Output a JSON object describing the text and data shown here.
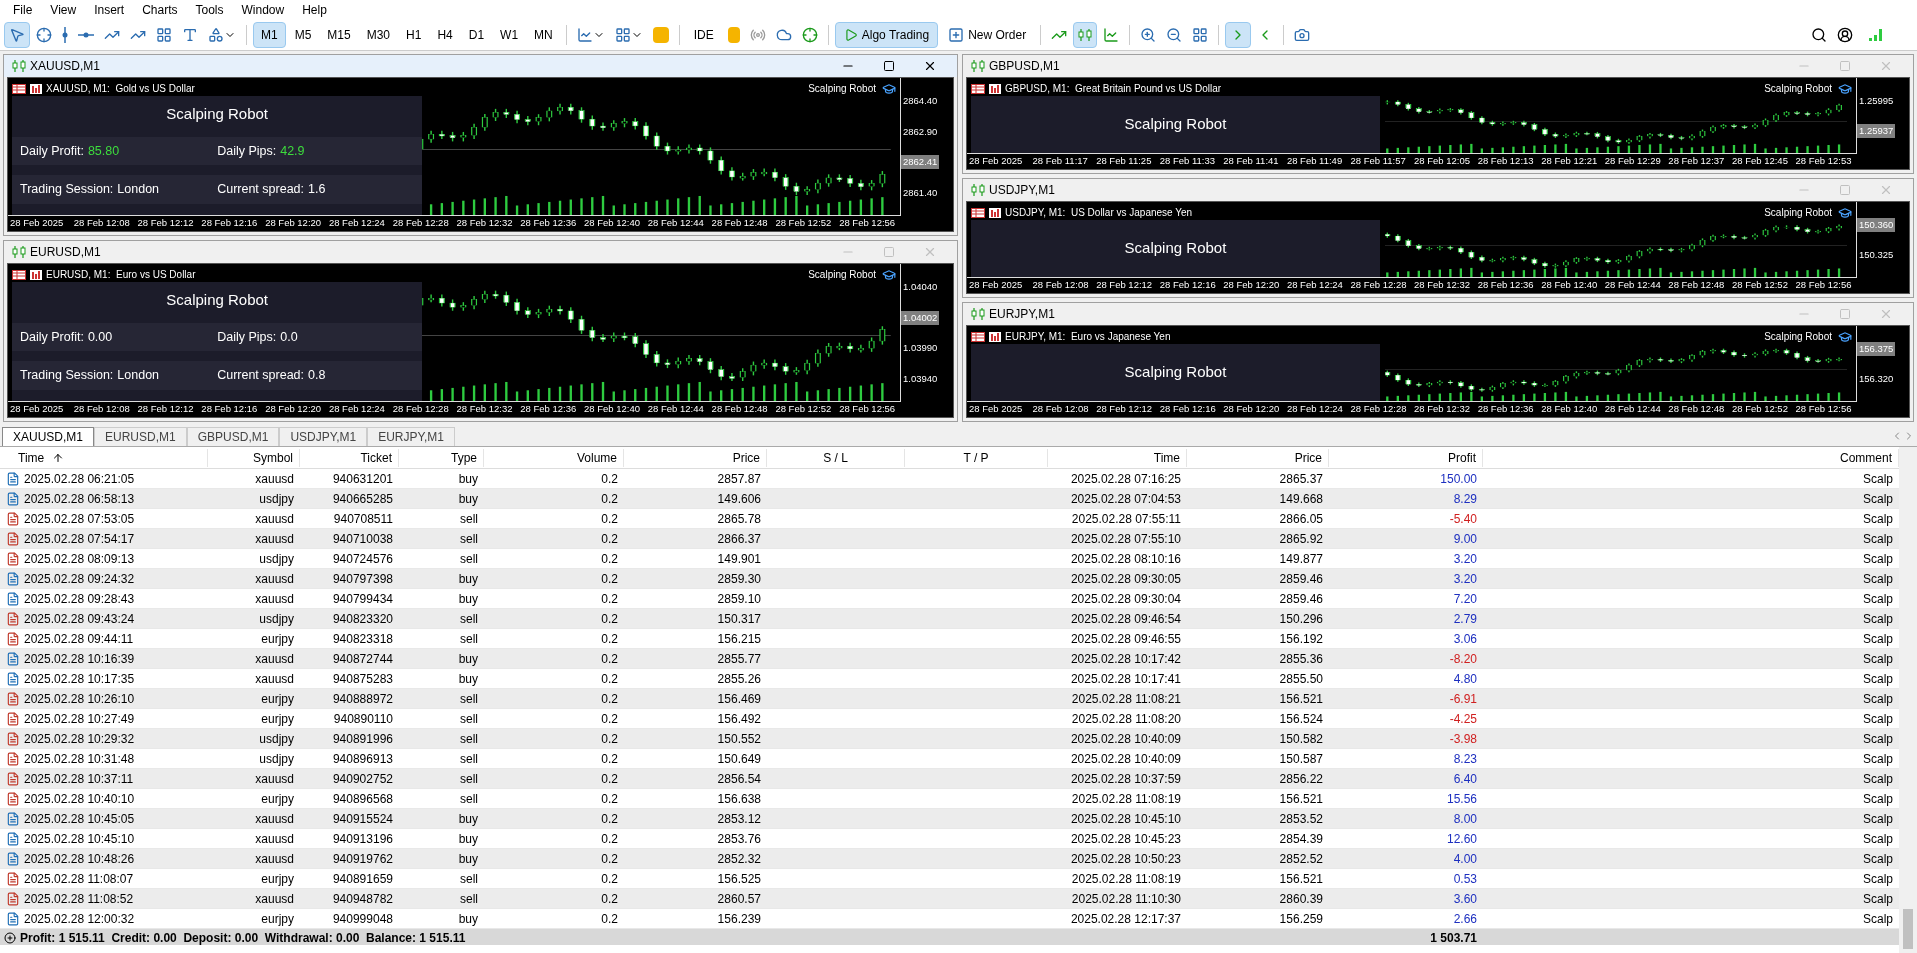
{
  "menu": [
    "File",
    "View",
    "Insert",
    "Charts",
    "Tools",
    "Window",
    "Help"
  ],
  "toolbar": {
    "timeframes": [
      {
        "label": "M1",
        "selected": true
      },
      {
        "label": "M5",
        "selected": false
      },
      {
        "label": "M15",
        "selected": false
      },
      {
        "label": "M30",
        "selected": false
      },
      {
        "label": "H1",
        "selected": false
      },
      {
        "label": "H4",
        "selected": false
      },
      {
        "label": "D1",
        "selected": false
      },
      {
        "label": "W1",
        "selected": false
      },
      {
        "label": "MN",
        "selected": false
      }
    ],
    "ide": "IDE",
    "algo_trading": {
      "label": "Algo Trading",
      "on": true
    },
    "new_order": "New Order"
  },
  "charts": [
    {
      "title": "XAUUSD,M1",
      "active": true,
      "symbol_text": "XAUUSD, M1:  Gold vs US Dollar",
      "robot_label": "Scalping Robot",
      "panel": {
        "title": "Scalping Robot",
        "rows": [
          [
            {
              "label": "Daily Profit:",
              "value": "85.80",
              "positive": true
            },
            {
              "label": "Daily Pips:",
              "value": "42.9",
              "positive": true
            }
          ],
          [
            {
              "label": "Trading Session:",
              "value": "London",
              "positive": false
            },
            {
              "label": "Current spread:",
              "value": "1.6",
              "positive": false
            }
          ]
        ]
      },
      "price_labels": [
        {
          "text": "2864.40",
          "current": false
        },
        {
          "text": "2862.90",
          "current": false
        },
        {
          "text": "2862.41",
          "current": true
        },
        {
          "text": "2861.40",
          "current": false
        }
      ],
      "time_labels": [
        "28 Feb 2025",
        "28 Feb 12:08",
        "28 Feb 12:12",
        "28 Feb 12:16",
        "28 Feb 12:20",
        "28 Feb 12:24",
        "28 Feb 12:28",
        "28 Feb 12:32",
        "28 Feb 12:36",
        "28 Feb 12:40",
        "28 Feb 12:44",
        "28 Feb 12:48",
        "28 Feb 12:52",
        "28 Feb 12:56"
      ]
    },
    {
      "title": "EURUSD,M1",
      "active": false,
      "symbol_text": "EURUSD, M1:  Euro vs US Dollar",
      "robot_label": "Scalping Robot",
      "panel": {
        "title": "Scalping Robot",
        "rows": [
          [
            {
              "label": "Daily Profit:",
              "value": "0.00",
              "positive": false
            },
            {
              "label": "Daily Pips:",
              "value": "0.0",
              "positive": false
            }
          ],
          [
            {
              "label": "Trading Session:",
              "value": "London",
              "positive": false
            },
            {
              "label": "Current spread:",
              "value": "0.8",
              "positive": false
            }
          ]
        ]
      },
      "price_labels": [
        {
          "text": "1.04040",
          "current": false
        },
        {
          "text": "1.04002",
          "current": true
        },
        {
          "text": "1.03990",
          "current": false
        },
        {
          "text": "1.03940",
          "current": false
        }
      ],
      "time_labels": [
        "28 Feb 2025",
        "28 Feb 12:08",
        "28 Feb 12:12",
        "28 Feb 12:16",
        "28 Feb 12:20",
        "28 Feb 12:24",
        "28 Feb 12:28",
        "28 Feb 12:32",
        "28 Feb 12:36",
        "28 Feb 12:40",
        "28 Feb 12:44",
        "28 Feb 12:48",
        "28 Feb 12:52",
        "28 Feb 12:56"
      ]
    },
    {
      "title": "GBPUSD,M1",
      "active": false,
      "symbol_text": "GBPUSD, M1:  Great Britain Pound vs US Dollar",
      "robot_label": "Scalping Robot",
      "panel": {
        "title": "Scalping Robot"
      },
      "price_labels": [
        {
          "text": "1.25995",
          "current": false
        },
        {
          "text": "1.25937",
          "current": true
        }
      ],
      "time_labels": [
        "28 Feb 2025",
        "28 Feb 11:17",
        "28 Feb 11:25",
        "28 Feb 11:33",
        "28 Feb 11:41",
        "28 Feb 11:49",
        "28 Feb 11:57",
        "28 Feb 12:05",
        "28 Feb 12:13",
        "28 Feb 12:21",
        "28 Feb 12:29",
        "28 Feb 12:37",
        "28 Feb 12:45",
        "28 Feb 12:53"
      ]
    },
    {
      "title": "USDJPY,M1",
      "active": false,
      "symbol_text": "USDJPY, M1:  US Dollar vs Japanese Yen",
      "robot_label": "Scalping Robot",
      "panel": {
        "title": "Scalping Robot"
      },
      "price_labels": [
        {
          "text": "150.360",
          "current": true
        },
        {
          "text": "150.325",
          "current": false
        }
      ],
      "time_labels": [
        "28 Feb 2025",
        "28 Feb 12:08",
        "28 Feb 12:12",
        "28 Feb 12:16",
        "28 Feb 12:20",
        "28 Feb 12:24",
        "28 Feb 12:28",
        "28 Feb 12:32",
        "28 Feb 12:36",
        "28 Feb 12:40",
        "28 Feb 12:44",
        "28 Feb 12:48",
        "28 Feb 12:52",
        "28 Feb 12:56"
      ]
    },
    {
      "title": "EURJPY,M1",
      "active": false,
      "symbol_text": "EURJPY, M1:  Euro vs Japanese Yen",
      "robot_label": "Scalping Robot",
      "panel": {
        "title": "Scalping Robot"
      },
      "price_labels": [
        {
          "text": "156.375",
          "current": true
        },
        {
          "text": "156.320",
          "current": false
        }
      ],
      "time_labels": [
        "28 Feb 2025",
        "28 Feb 12:08",
        "28 Feb 12:12",
        "28 Feb 12:16",
        "28 Feb 12:20",
        "28 Feb 12:24",
        "28 Feb 12:28",
        "28 Feb 12:32",
        "28 Feb 12:36",
        "28 Feb 12:40",
        "28 Feb 12:44",
        "28 Feb 12:48",
        "28 Feb 12:52",
        "28 Feb 12:56"
      ]
    }
  ],
  "chart_tabs": [
    {
      "label": "XAUUSD,M1",
      "selected": true
    },
    {
      "label": "EURUSD,M1",
      "selected": false
    },
    {
      "label": "GBPUSD,M1",
      "selected": false
    },
    {
      "label": "USDJPY,M1",
      "selected": false
    },
    {
      "label": "EURJPY,M1",
      "selected": false
    }
  ],
  "table": {
    "columns": [
      "Time",
      "Symbol",
      "Ticket",
      "Type",
      "Volume",
      "Price",
      "S / L",
      "T / P",
      "Time",
      "Price",
      "Profit",
      "Comment"
    ],
    "rows": [
      {
        "kind": "buy",
        "time": "2025.02.28 06:21:05",
        "symbol": "xauusd",
        "ticket": "940631201",
        "type": "buy",
        "volume": "0.2",
        "price": "2857.87",
        "close_time": "2025.02.28 07:16:25",
        "close_price": "2865.37",
        "profit": "150.00",
        "loss": false,
        "comment": "Scalp"
      },
      {
        "kind": "buy",
        "time": "2025.02.28 06:58:13",
        "symbol": "usdjpy",
        "ticket": "940665285",
        "type": "buy",
        "volume": "0.2",
        "price": "149.606",
        "close_time": "2025.02.28 07:04:53",
        "close_price": "149.668",
        "profit": "8.29",
        "loss": false,
        "comment": "Scalp"
      },
      {
        "kind": "sell",
        "time": "2025.02.28 07:53:05",
        "symbol": "xauusd",
        "ticket": "940708511",
        "type": "sell",
        "volume": "0.2",
        "price": "2865.78",
        "close_time": "2025.02.28 07:55:11",
        "close_price": "2866.05",
        "profit": "-5.40",
        "loss": true,
        "comment": "Scalp"
      },
      {
        "kind": "sell",
        "time": "2025.02.28 07:54:17",
        "symbol": "xauusd",
        "ticket": "940710038",
        "type": "sell",
        "volume": "0.2",
        "price": "2866.37",
        "close_time": "2025.02.28 07:55:10",
        "close_price": "2865.92",
        "profit": "9.00",
        "loss": false,
        "comment": "Scalp"
      },
      {
        "kind": "sell",
        "time": "2025.02.28 08:09:13",
        "symbol": "usdjpy",
        "ticket": "940724576",
        "type": "sell",
        "volume": "0.2",
        "price": "149.901",
        "close_time": "2025.02.28 08:10:16",
        "close_price": "149.877",
        "profit": "3.20",
        "loss": false,
        "comment": "Scalp"
      },
      {
        "kind": "buy",
        "time": "2025.02.28 09:24:32",
        "symbol": "xauusd",
        "ticket": "940797398",
        "type": "buy",
        "volume": "0.2",
        "price": "2859.30",
        "close_time": "2025.02.28 09:30:05",
        "close_price": "2859.46",
        "profit": "3.20",
        "loss": false,
        "comment": "Scalp"
      },
      {
        "kind": "buy",
        "time": "2025.02.28 09:28:43",
        "symbol": "xauusd",
        "ticket": "940799434",
        "type": "buy",
        "volume": "0.2",
        "price": "2859.10",
        "close_time": "2025.02.28 09:30:04",
        "close_price": "2859.46",
        "profit": "7.20",
        "loss": false,
        "comment": "Scalp"
      },
      {
        "kind": "sell",
        "time": "2025.02.28 09:43:24",
        "symbol": "usdjpy",
        "ticket": "940823320",
        "type": "sell",
        "volume": "0.2",
        "price": "150.317",
        "close_time": "2025.02.28 09:46:54",
        "close_price": "150.296",
        "profit": "2.79",
        "loss": false,
        "comment": "Scalp"
      },
      {
        "kind": "sell",
        "time": "2025.02.28 09:44:11",
        "symbol": "eurjpy",
        "ticket": "940823318",
        "type": "sell",
        "volume": "0.2",
        "price": "156.215",
        "close_time": "2025.02.28 09:46:55",
        "close_price": "156.192",
        "profit": "3.06",
        "loss": false,
        "comment": "Scalp"
      },
      {
        "kind": "buy",
        "time": "2025.02.28 10:16:39",
        "symbol": "xauusd",
        "ticket": "940872744",
        "type": "buy",
        "volume": "0.2",
        "price": "2855.77",
        "close_time": "2025.02.28 10:17:42",
        "close_price": "2855.36",
        "profit": "-8.20",
        "loss": true,
        "comment": "Scalp"
      },
      {
        "kind": "buy",
        "time": "2025.02.28 10:17:35",
        "symbol": "xauusd",
        "ticket": "940875283",
        "type": "buy",
        "volume": "0.2",
        "price": "2855.26",
        "close_time": "2025.02.28 10:17:41",
        "close_price": "2855.50",
        "profit": "4.80",
        "loss": false,
        "comment": "Scalp"
      },
      {
        "kind": "sell",
        "time": "2025.02.28 10:26:10",
        "symbol": "eurjpy",
        "ticket": "940888972",
        "type": "sell",
        "volume": "0.2",
        "price": "156.469",
        "close_time": "2025.02.28 11:08:21",
        "close_price": "156.521",
        "profit": "-6.91",
        "loss": true,
        "comment": "Scalp"
      },
      {
        "kind": "sell",
        "time": "2025.02.28 10:27:49",
        "symbol": "eurjpy",
        "ticket": "940890110",
        "type": "sell",
        "volume": "0.2",
        "price": "156.492",
        "close_time": "2025.02.28 11:08:20",
        "close_price": "156.524",
        "profit": "-4.25",
        "loss": true,
        "comment": "Scalp"
      },
      {
        "kind": "sell",
        "time": "2025.02.28 10:29:32",
        "symbol": "usdjpy",
        "ticket": "940891996",
        "type": "sell",
        "volume": "0.2",
        "price": "150.552",
        "close_time": "2025.02.28 10:40:09",
        "close_price": "150.582",
        "profit": "-3.98",
        "loss": true,
        "comment": "Scalp"
      },
      {
        "kind": "sell",
        "time": "2025.02.28 10:31:48",
        "symbol": "usdjpy",
        "ticket": "940896913",
        "type": "sell",
        "volume": "0.2",
        "price": "150.649",
        "close_time": "2025.02.28 10:40:09",
        "close_price": "150.587",
        "profit": "8.23",
        "loss": false,
        "comment": "Scalp"
      },
      {
        "kind": "sell",
        "time": "2025.02.28 10:37:11",
        "symbol": "xauusd",
        "ticket": "940902752",
        "type": "sell",
        "volume": "0.2",
        "price": "2856.54",
        "close_time": "2025.02.28 10:37:59",
        "close_price": "2856.22",
        "profit": "6.40",
        "loss": false,
        "comment": "Scalp"
      },
      {
        "kind": "sell",
        "time": "2025.02.28 10:40:10",
        "symbol": "eurjpy",
        "ticket": "940896568",
        "type": "sell",
        "volume": "0.2",
        "price": "156.638",
        "close_time": "2025.02.28 11:08:19",
        "close_price": "156.521",
        "profit": "15.56",
        "loss": false,
        "comment": "Scalp"
      },
      {
        "kind": "buy",
        "time": "2025.02.28 10:45:05",
        "symbol": "xauusd",
        "ticket": "940915524",
        "type": "buy",
        "volume": "0.2",
        "price": "2853.12",
        "close_time": "2025.02.28 10:45:10",
        "close_price": "2853.52",
        "profit": "8.00",
        "loss": false,
        "comment": "Scalp"
      },
      {
        "kind": "buy",
        "time": "2025.02.28 10:45:10",
        "symbol": "xauusd",
        "ticket": "940913196",
        "type": "buy",
        "volume": "0.2",
        "price": "2853.76",
        "close_time": "2025.02.28 10:45:23",
        "close_price": "2854.39",
        "profit": "12.60",
        "loss": false,
        "comment": "Scalp"
      },
      {
        "kind": "buy",
        "time": "2025.02.28 10:48:26",
        "symbol": "xauusd",
        "ticket": "940919762",
        "type": "buy",
        "volume": "0.2",
        "price": "2852.32",
        "close_time": "2025.02.28 10:50:23",
        "close_price": "2852.52",
        "profit": "4.00",
        "loss": false,
        "comment": "Scalp"
      },
      {
        "kind": "sell",
        "time": "2025.02.28 11:08:07",
        "symbol": "eurjpy",
        "ticket": "940891659",
        "type": "sell",
        "volume": "0.2",
        "price": "156.525",
        "close_time": "2025.02.28 11:08:19",
        "close_price": "156.521",
        "profit": "0.53",
        "loss": false,
        "comment": "Scalp"
      },
      {
        "kind": "sell",
        "time": "2025.02.28 11:08:52",
        "symbol": "xauusd",
        "ticket": "940948782",
        "type": "sell",
        "volume": "0.2",
        "price": "2860.57",
        "close_time": "2025.02.28 11:10:30",
        "close_price": "2860.39",
        "profit": "3.60",
        "loss": false,
        "comment": "Scalp"
      },
      {
        "kind": "buy",
        "time": "2025.02.28 12:00:32",
        "symbol": "eurjpy",
        "ticket": "940999048",
        "type": "buy",
        "volume": "0.2",
        "price": "156.239",
        "close_time": "2025.02.28 12:17:37",
        "close_price": "156.259",
        "profit": "2.66",
        "loss": false,
        "comment": "Scalp"
      }
    ]
  },
  "status_bar": {
    "summary": "Profit: 1 515.11  Credit: 0.00  Deposit: 0.00  Withdrawal: 0.00  Balance: 1 515.11",
    "total": "1 503.71"
  }
}
